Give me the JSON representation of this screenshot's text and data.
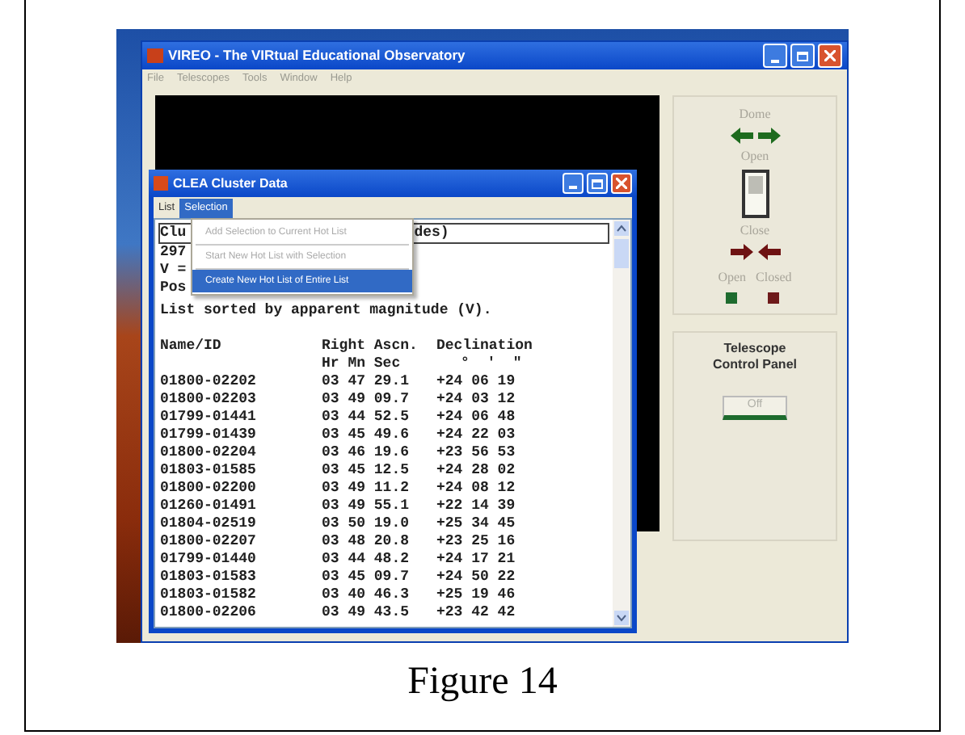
{
  "main_window": {
    "title": "VIREO - The VIRtual Educational Observatory",
    "menu": [
      "File",
      "Telescopes",
      "Tools",
      "Window",
      "Help"
    ],
    "dome_panel": {
      "title": "Dome",
      "open_label": "Open",
      "close_label": "Close",
      "switch_on": false,
      "indicators": [
        {
          "label": "Open",
          "color": "#1e6b2e"
        },
        {
          "label": "Closed",
          "color": "#6e1a1a"
        }
      ]
    },
    "telescope_panel": {
      "title": "Telescope Control Panel",
      "power_button": "Off"
    }
  },
  "cluster_window": {
    "title": "CLEA Cluster Data",
    "menu": [
      {
        "label": "List",
        "selected": false
      },
      {
        "label": "Selection",
        "selected": true
      }
    ],
    "dropdown": [
      {
        "label": "Add Selection to Current Hot List",
        "disabled": true,
        "selected": false
      },
      {
        "label": "Start New Hot List with Selection",
        "disabled": true,
        "selected": false
      },
      {
        "label": "Create New Hot List of Entire List",
        "disabled": false,
        "selected": true
      }
    ],
    "first_line": {
      "start": "Clu",
      "end": "des)"
    },
    "header_lines": [
      "297",
      "V =",
      "Pos"
    ],
    "sort_note": "List sorted by apparent magnitude (V).",
    "columns": [
      "Name/ID",
      "Right Ascn.",
      "Declination"
    ],
    "units": [
      "Hr Mn Sec",
      "°  '  \""
    ],
    "rows": [
      [
        "01800-02202",
        "03 47 29.1",
        "+24 06 19"
      ],
      [
        "01800-02203",
        "03 49 09.7",
        "+24 03 12"
      ],
      [
        "01799-01441",
        "03 44 52.5",
        "+24 06 48"
      ],
      [
        "01799-01439",
        "03 45 49.6",
        "+24 22 03"
      ],
      [
        "01800-02204",
        "03 46 19.6",
        "+23 56 53"
      ],
      [
        "01803-01585",
        "03 45 12.5",
        "+24 28 02"
      ],
      [
        "01800-02200",
        "03 49 11.2",
        "+24 08 12"
      ],
      [
        "01260-01491",
        "03 49 55.1",
        "+22 14 39"
      ],
      [
        "01804-02519",
        "03 50 19.0",
        "+25 34 45"
      ],
      [
        "01800-02207",
        "03 48 20.8",
        "+23 25 16"
      ],
      [
        "01799-01440",
        "03 44 48.2",
        "+24 17 21"
      ],
      [
        "01803-01583",
        "03 45 09.7",
        "+24 50 22"
      ],
      [
        "01803-01582",
        "03 40 46.3",
        "+25 19 46"
      ],
      [
        "01800-02206",
        "03 49 43.5",
        "+23 42 42"
      ]
    ]
  },
  "caption": "Figure 14"
}
